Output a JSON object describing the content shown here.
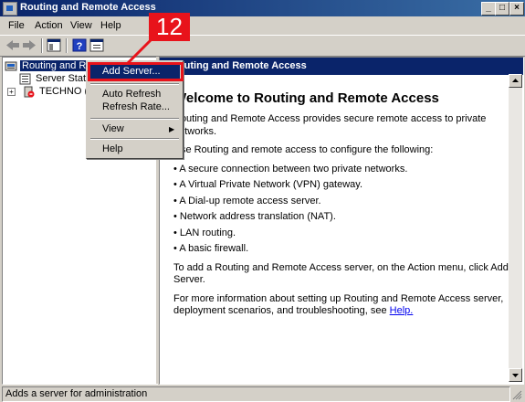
{
  "window": {
    "title": "Routing and Remote Access"
  },
  "title_buttons": {
    "minimize": "_",
    "maximize": "□",
    "close": "×"
  },
  "menubar": [
    "File",
    "Action",
    "View",
    "Help"
  ],
  "toolbar_icons": [
    "back-arrow-icon",
    "forward-arrow-icon",
    "show-hide-tree-icon",
    "help-icon",
    "properties-icon"
  ],
  "tree": {
    "root": "Routing and Remote Access",
    "children": [
      {
        "label": "Server Status",
        "icon": "server-status-icon"
      },
      {
        "label": "TECHNO (local)",
        "icon": "server-down-icon",
        "expander": "+"
      }
    ]
  },
  "context_menu": {
    "items": [
      "Add Server...",
      "Auto Refresh",
      "Refresh Rate...",
      "View",
      "Help"
    ],
    "submenu_arrow": "▶"
  },
  "annotation": {
    "number": "12",
    "color": "#e8131b"
  },
  "content": {
    "header": "Routing and Remote Access",
    "heading": "Welcome to Routing and Remote Access",
    "intro": "Routing and Remote Access provides secure remote access to private networks.",
    "use_line": "Use Routing and remote access to configure the following:",
    "bullets": [
      "A secure connection between two private networks.",
      "A Virtual Private Network (VPN) gateway.",
      "A Dial-up remote access server.",
      "Network address translation (NAT).",
      "LAN routing.",
      "A basic firewall."
    ],
    "add_server_text": "To add a Routing and Remote Access server, on the Action menu, click Add Server.",
    "more_info_text": "For more information about setting up Routing and Remote Access server, deployment scenarios, and troubleshooting, see",
    "help_link": "Help."
  },
  "statusbar": {
    "text": "Adds a server for administration"
  },
  "colors": {
    "title_bar": "#0a246a",
    "selection": "#0a246a",
    "annotation": "#e8131b",
    "chrome": "#d4d0c8"
  }
}
